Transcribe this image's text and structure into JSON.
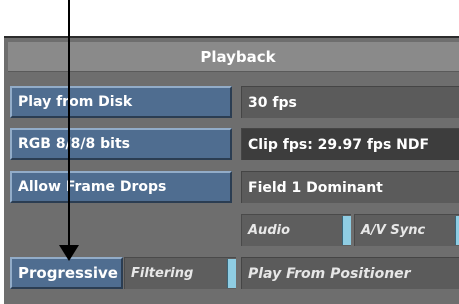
{
  "panel": {
    "title": "Playback"
  },
  "left_buttons": [
    {
      "label": "Play from Disk"
    },
    {
      "label": "RGB 8/8/8 bits"
    },
    {
      "label": "Allow Frame Drops"
    },
    {
      "label": "Progressive"
    }
  ],
  "filtering_toggle": {
    "label": "Filtering"
  },
  "right_fields": {
    "fps": "30 fps",
    "clip_fps": "Clip fps: 29.97 fps NDF",
    "field_dominance": "Field 1 Dominant",
    "play_from": "Play From Positioner"
  },
  "toggles": {
    "audio": "Audio",
    "av_sync": "A/V Sync"
  },
  "colors": {
    "button_blue": "#4f6d90",
    "indicator_cyan": "#8fcde3",
    "panel_gray": "#6e6e6e",
    "callout_arrow": "#000000"
  },
  "callout": {
    "icon": "down-arrow-icon"
  }
}
